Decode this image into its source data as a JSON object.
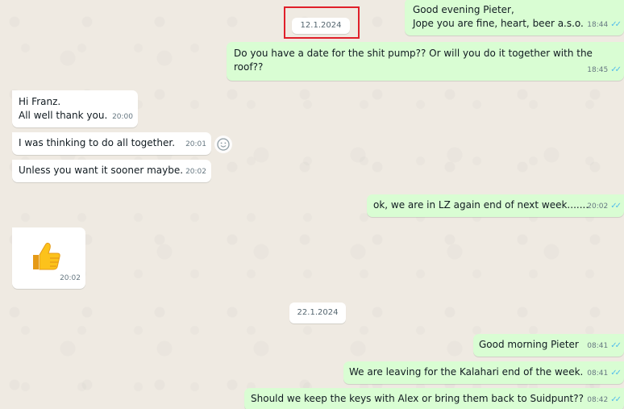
{
  "chat": {
    "dates": {
      "first": "12.1.2024",
      "second": "22.1.2024"
    },
    "messages": [
      {
        "text": "Good evening Pieter,\nJope you are fine, heart, beer a.s.o.",
        "time": "18:44",
        "direction": "out"
      },
      {
        "text": "Do you have a date for the shit pump?? Or will you do it together with the roof??",
        "time": "18:45",
        "direction": "out"
      },
      {
        "text": "Hi Franz.\nAll well thank you.",
        "time": "20:00",
        "direction": "in"
      },
      {
        "text": "I was thinking to do all together.",
        "time": "20:01",
        "direction": "in"
      },
      {
        "text": "Unless you want it sooner maybe.",
        "time": "20:02",
        "direction": "in"
      },
      {
        "text": "ok, we are in LZ again end of next week.......",
        "time": "20:02",
        "direction": "out"
      },
      {
        "sticker": "thumbs-up",
        "time": "20:02",
        "direction": "in"
      },
      {
        "text": "Good morning Pieter",
        "time": "08:41",
        "direction": "out"
      },
      {
        "text": "We are leaving for the Kalahari end of the week.",
        "time": "08:41",
        "direction": "out"
      },
      {
        "text": "Should we keep the keys with Alex or bring them back to Suidpunt??",
        "time": "08:42",
        "direction": "out"
      }
    ]
  },
  "colors": {
    "outgoing": "#d9fdd3",
    "incoming": "#ffffff",
    "background": "#efeae2",
    "read_ticks": "#53bdeb",
    "highlight": "#e0202a"
  }
}
